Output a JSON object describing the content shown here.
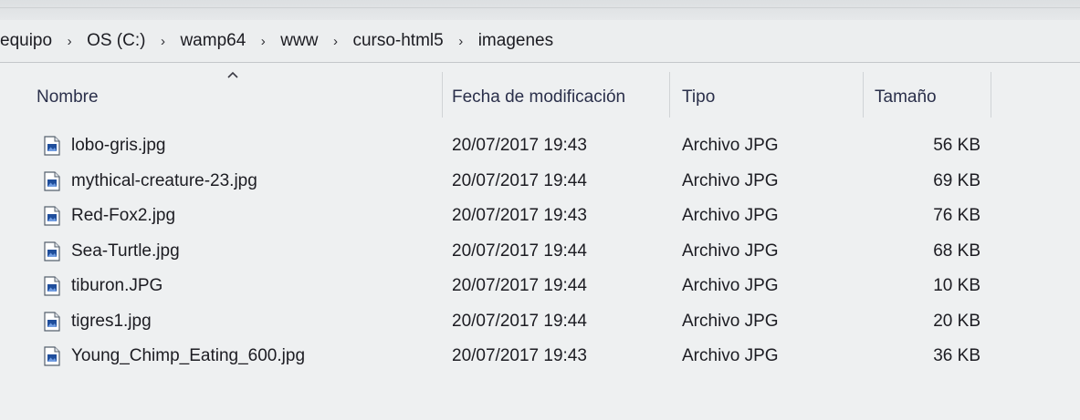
{
  "breadcrumb": {
    "items": [
      "equipo",
      "OS (C:)",
      "wamp64",
      "www",
      "curso-html5",
      "imagenes"
    ],
    "separator": "›"
  },
  "columns": {
    "name": "Nombre",
    "date": "Fecha de modificación",
    "type": "Tipo",
    "size": "Tamaño",
    "sorted_by": "name",
    "sort_direction": "ascending"
  },
  "files": [
    {
      "name": "lobo-gris.jpg",
      "date": "20/07/2017 19:43",
      "type": "Archivo JPG",
      "size": "56 KB",
      "icon": "jpg-file-icon"
    },
    {
      "name": "mythical-creature-23.jpg",
      "date": "20/07/2017 19:44",
      "type": "Archivo JPG",
      "size": "69 KB",
      "icon": "jpg-file-icon"
    },
    {
      "name": "Red-Fox2.jpg",
      "date": "20/07/2017 19:43",
      "type": "Archivo JPG",
      "size": "76 KB",
      "icon": "jpg-file-icon"
    },
    {
      "name": "Sea-Turtle.jpg",
      "date": "20/07/2017 19:44",
      "type": "Archivo JPG",
      "size": "68 KB",
      "icon": "jpg-file-icon"
    },
    {
      "name": "tiburon.JPG",
      "date": "20/07/2017 19:44",
      "type": "Archivo JPG",
      "size": "10 KB",
      "icon": "jpg-file-icon"
    },
    {
      "name": "tigres1.jpg",
      "date": "20/07/2017 19:44",
      "type": "Archivo JPG",
      "size": "20 KB",
      "icon": "jpg-file-icon"
    },
    {
      "name": "Young_Chimp_Eating_600.jpg",
      "date": "20/07/2017 19:43",
      "type": "Archivo JPG",
      "size": "36 KB",
      "icon": "jpg-file-icon"
    }
  ],
  "colors": {
    "icon_blue": "#1f4e9c",
    "header_text": "#2a2f4a",
    "background": "#eef0f1"
  }
}
